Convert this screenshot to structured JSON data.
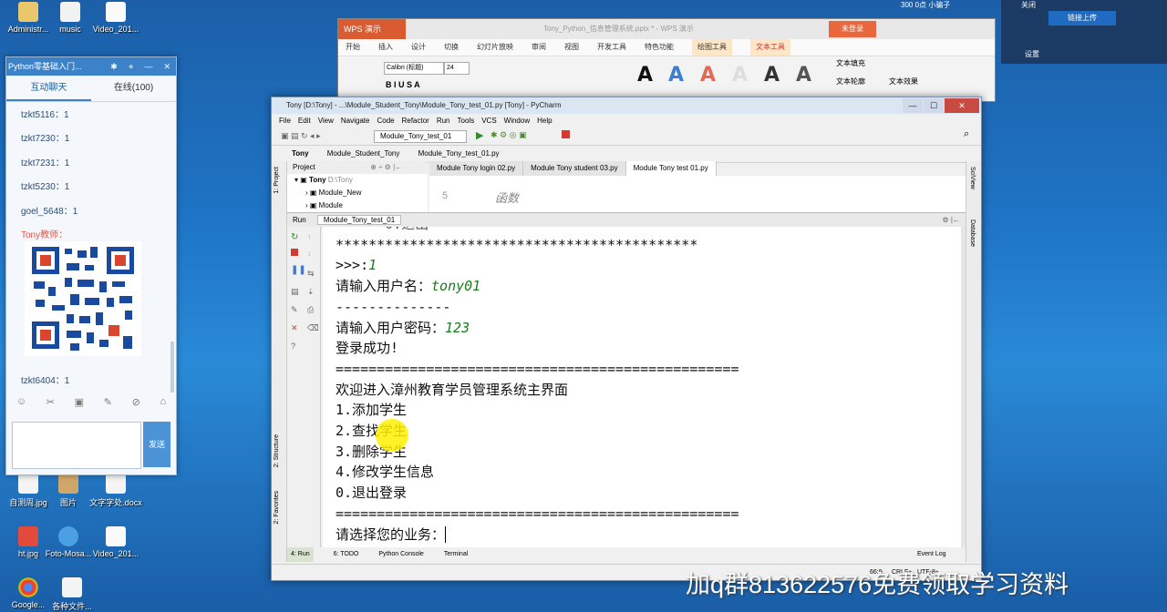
{
  "desktop": {
    "icons_top": [
      {
        "label": "Administr..."
      },
      {
        "label": "music"
      },
      {
        "label": "Video_201..."
      }
    ],
    "icons_bottom_row1": [
      {
        "label": "自测周.jpg"
      },
      {
        "label": "图片"
      },
      {
        "label": "文字字处.docx"
      }
    ],
    "icons_bottom_row2": [
      {
        "label": "ht.jpg"
      },
      {
        "label": "Foto-Mosa..."
      },
      {
        "label": "Video_201..."
      }
    ],
    "icons_bottom_row3": [
      {
        "label": "Google..."
      },
      {
        "label": "各种文件..."
      }
    ],
    "top_right_labels": {
      "a": "300 0点 小骗子",
      "b": "关闭",
      "upload": "链接上传",
      "settings": "设置"
    }
  },
  "chat": {
    "title": "Python零基础入门...",
    "tabs": [
      "互动聊天",
      "在线(100)"
    ],
    "messages": [
      "tzkt5116：1",
      "tzkt7230：1",
      "tzkt7231：1",
      "tzkt5230：1",
      "goel_5648：1",
      "Tony教师："
    ],
    "last_message": "tzkt6404：1",
    "send_label": "发送"
  },
  "wps": {
    "logo": "WPS 演示",
    "title": "Tony_Python_信息管理系统.pptx * - WPS 演示",
    "login": "未登录",
    "menu": [
      "开始",
      "插入",
      "设计",
      "切换",
      "幻灯片放映",
      "审阅",
      "视图",
      "开发工具",
      "特色功能",
      "绘图工具",
      "文本工具"
    ],
    "font": "Calibri (标题)",
    "size": "24",
    "text_fill": "文本填充",
    "text_outline": "文本轮廓",
    "text_effect": "文本效果"
  },
  "pycharm": {
    "title": "Tony [D:\\Tony] - ...\\Module_Student_Tony\\Module_Tony_test_01.py [Tony] - PyCharm",
    "menu": [
      "File",
      "Edit",
      "View",
      "Navigate",
      "Code",
      "Refactor",
      "Run",
      "Tools",
      "VCS",
      "Window",
      "Help"
    ],
    "run_config": "Module_Tony_test_01",
    "breadcrumbs": [
      "Tony",
      "Module_Student_Tony",
      "Module_Tony_test_01.py"
    ],
    "project_label": "Project",
    "project_tree": [
      {
        "name": "Tony",
        "path": "D:\\Tony"
      },
      {
        "name": "Module_New",
        "path": ""
      },
      {
        "name": "Module",
        "path": ""
      }
    ],
    "editor_tabs": [
      "Module Tony login 02.py",
      "Module Tony student 03.py",
      "Module Tony test 01.py"
    ],
    "editor_line_no": "5",
    "editor_line_text": "函数",
    "run_label": "Run",
    "run_tab": "Module_Tony_test_01",
    "console": {
      "l0": "      0.退出",
      "l1": "********************************************",
      "l2_prompt": ">>>:",
      "l2_input": "1",
      "l3_prompt": "请输入用户名：",
      "l3_input": "tony01",
      "l4": "--------------",
      "l5_prompt": "请输入用户密码：",
      "l5_input": "123",
      "l6": "登录成功!",
      "l7": "=================================================",
      "l8": "欢迎进入漳州教育学员管理系统主界面",
      "l9": "1.添加学生",
      "l10": "2.查找学生",
      "l11": "3.删除学生",
      "l12": "4.修改学生信息",
      "l13": "0.退出登录",
      "l14": "=================================================",
      "l15": "请选择您的业务："
    },
    "tool_windows": [
      "4: Run",
      "6: TODO",
      "Python Console",
      "Terminal"
    ],
    "event_log": "Event Log",
    "status_pos": "66:9",
    "status_crlf": "CRLF÷",
    "status_enc": "UTF-8÷",
    "side_left": [
      "1: Project",
      "2: Structure",
      "2: Favorites"
    ],
    "side_right": [
      "SciView",
      "Database"
    ]
  },
  "watermark": "加q群813622576免费领取学习资料"
}
